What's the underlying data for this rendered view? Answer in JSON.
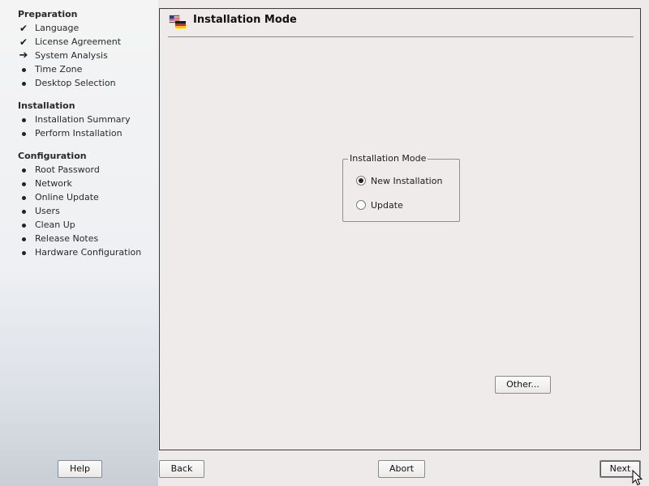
{
  "sidebar": {
    "sections": [
      {
        "title": "Preparation",
        "items": [
          {
            "label": "Language",
            "state": "done"
          },
          {
            "label": "License Agreement",
            "state": "done"
          },
          {
            "label": "System Analysis",
            "state": "current"
          },
          {
            "label": "Time Zone",
            "state": "pending"
          },
          {
            "label": "Desktop Selection",
            "state": "pending"
          }
        ]
      },
      {
        "title": "Installation",
        "items": [
          {
            "label": "Installation Summary",
            "state": "pending"
          },
          {
            "label": "Perform Installation",
            "state": "pending"
          }
        ]
      },
      {
        "title": "Configuration",
        "items": [
          {
            "label": "Root Password",
            "state": "pending"
          },
          {
            "label": "Network",
            "state": "pending"
          },
          {
            "label": "Online Update",
            "state": "pending"
          },
          {
            "label": "Users",
            "state": "pending"
          },
          {
            "label": "Clean Up",
            "state": "pending"
          },
          {
            "label": "Release Notes",
            "state": "pending"
          },
          {
            "label": "Hardware Configuration",
            "state": "pending"
          }
        ]
      }
    ],
    "icons": {
      "done": "check-icon",
      "current": "arrow-right-icon",
      "pending": "bullet-icon"
    }
  },
  "content": {
    "title": "Installation Mode",
    "title_icon": "flags-icon",
    "mode_group": {
      "legend": "Installation Mode",
      "options": [
        {
          "label": "New Installation",
          "selected": true
        },
        {
          "label": "Update",
          "selected": false
        }
      ]
    },
    "other_button": "Other..."
  },
  "buttons": {
    "help": "Help",
    "back": "Back",
    "abort": "Abort",
    "next": "Next"
  }
}
